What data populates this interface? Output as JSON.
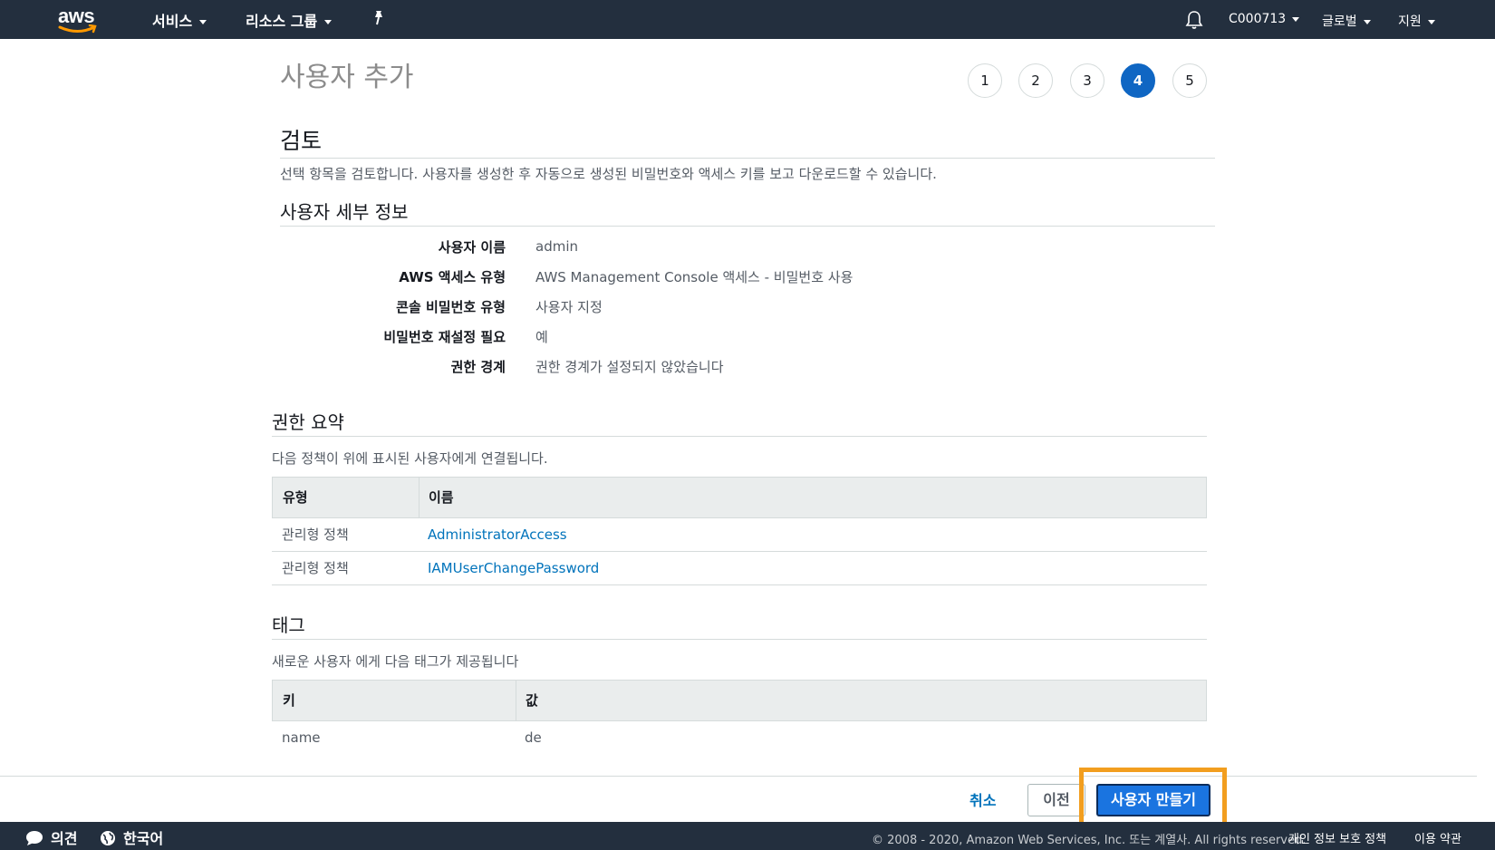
{
  "topnav": {
    "logo_text": "aws",
    "services": "서비스",
    "resource_groups": "리소스 그룹",
    "account": "C000713",
    "region": "글로벌",
    "support": "지원"
  },
  "wizard": {
    "title": "사용자 추가",
    "steps": [
      "1",
      "2",
      "3",
      "4",
      "5"
    ],
    "active_step": "4"
  },
  "review": {
    "heading": "검토",
    "description": "선택 항목을 검토합니다. 사용자를 생성한 후 자동으로 생성된 비밀번호와 액세스 키를 보고 다운로드할 수 있습니다."
  },
  "user_details": {
    "heading": "사용자 세부 정보",
    "rows": [
      {
        "label": "사용자 이름",
        "value": "admin"
      },
      {
        "label": "AWS 액세스 유형",
        "value": "AWS Management Console 액세스 - 비밀번호 사용"
      },
      {
        "label": "콘솔 비밀번호 유형",
        "value": "사용자 지정"
      },
      {
        "label": "비밀번호 재설정 필요",
        "value": "예"
      },
      {
        "label": "권한 경계",
        "value": "권한 경계가 설정되지 않았습니다"
      }
    ]
  },
  "permissions": {
    "heading": "권한 요약",
    "description": "다음 정책이 위에 표시된 사용자에게 연결됩니다.",
    "columns": [
      "유형",
      "이름"
    ],
    "rows": [
      {
        "type": "관리형 정책",
        "name": "AdministratorAccess"
      },
      {
        "type": "관리형 정책",
        "name": "IAMUserChangePassword"
      }
    ]
  },
  "tags": {
    "heading": "태그",
    "description": "새로운 사용자 에게 다음 태그가 제공됩니다",
    "columns": [
      "키",
      "값"
    ],
    "rows": [
      {
        "key": "name",
        "value": "de"
      }
    ]
  },
  "actions": {
    "cancel": "취소",
    "previous": "이전",
    "create": "사용자 만들기",
    "highlight_color": "#f29e1f"
  },
  "footer": {
    "feedback": "의견",
    "language": "한국어",
    "copyright": "© 2008 - 2020, Amazon Web Services, Inc. 또는 계열사. All rights reserved.",
    "privacy": "개인 정보 보호 정책",
    "terms": "이용 약관"
  },
  "colors": {
    "nav_bg": "#232f3e",
    "primary": "#1a74e0",
    "link": "#0073bb",
    "step_active": "#0f66c3"
  }
}
